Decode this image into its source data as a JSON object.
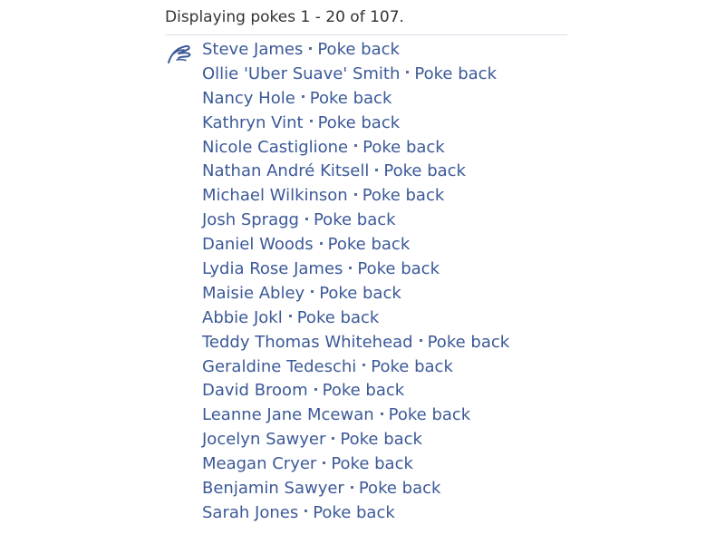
{
  "header": {
    "text": "Displaying pokes 1 - 20 of 107."
  },
  "icon": "poke-hand-icon",
  "colors": {
    "link": "#3b5998",
    "header_text": "#333333",
    "divider": "#d8dfea"
  },
  "pokes": [
    {
      "name": "Steve James",
      "action": "Poke back"
    },
    {
      "name": "Ollie 'Uber Suave' Smith",
      "action": "Poke back"
    },
    {
      "name": "Nancy Hole",
      "action": "Poke back"
    },
    {
      "name": "Kathryn Vint",
      "action": "Poke back"
    },
    {
      "name": "Nicole Castiglione",
      "action": "Poke back"
    },
    {
      "name": "Nathan André Kitsell",
      "action": "Poke back"
    },
    {
      "name": "Michael Wilkinson",
      "action": "Poke back"
    },
    {
      "name": "Josh Spragg",
      "action": "Poke back"
    },
    {
      "name": "Daniel Woods",
      "action": "Poke back"
    },
    {
      "name": "Lydia Rose James",
      "action": "Poke back"
    },
    {
      "name": "Maisie Abley",
      "action": "Poke back"
    },
    {
      "name": "Abbie Jokl",
      "action": "Poke back"
    },
    {
      "name": "Teddy Thomas Whitehead",
      "action": "Poke back"
    },
    {
      "name": "Geraldine Tedeschi",
      "action": "Poke back"
    },
    {
      "name": "David Broom",
      "action": "Poke back"
    },
    {
      "name": "Leanne Jane Mcewan",
      "action": "Poke back"
    },
    {
      "name": "Jocelyn Sawyer",
      "action": "Poke back"
    },
    {
      "name": "Meagan Cryer",
      "action": "Poke back"
    },
    {
      "name": "Benjamin Sawyer",
      "action": "Poke back"
    },
    {
      "name": "Sarah Jones",
      "action": "Poke back"
    }
  ]
}
